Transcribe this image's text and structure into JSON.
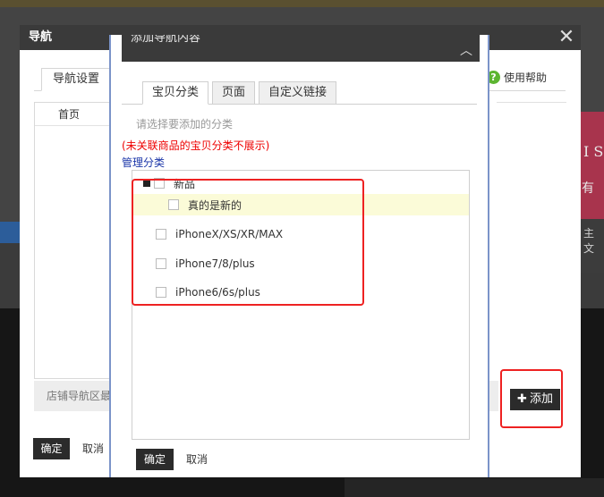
{
  "background": {
    "pink_text_1": "I S",
    "pink_text_2": "有",
    "mid_text": "主 文"
  },
  "outer_dialog": {
    "title": "导航",
    "close_glyph": "✕",
    "tab_label": "导航设置",
    "help": {
      "icon_glyph": "?",
      "label": "使用帮助"
    },
    "left_panel_header": "首页",
    "left_note": "店铺导航区最多",
    "add_button": {
      "plus": "✚",
      "label": "添加"
    },
    "confirm_label": "确定",
    "cancel_label": "取消"
  },
  "inner_dialog": {
    "title": "添加导航内容",
    "collapse_glyph": "︿",
    "tabs": [
      {
        "label": "宝贝分类",
        "active": true
      },
      {
        "label": "页面",
        "active": false
      },
      {
        "label": "自定义链接",
        "active": false
      }
    ],
    "hint": "请选择要添加的分类",
    "warning": "(未关联商品的宝贝分类不展示)",
    "manage_link": "管理分类",
    "tree": [
      {
        "label": "新品",
        "expanded": true,
        "level": 0
      },
      {
        "label": "真的是新的",
        "level": 1,
        "highlighted": true
      },
      {
        "label": "iPhoneX/XS/XR/MAX",
        "level": 0
      },
      {
        "label": "iPhone7/8/plus",
        "level": 0
      },
      {
        "label": "iPhone6/6s/plus",
        "level": 0
      }
    ],
    "confirm_label": "确定",
    "cancel_label": "取消"
  },
  "colors": {
    "title_bar": "#3a3a3a",
    "highlight_border": "#ee2222",
    "warning_text": "#ee0000",
    "link_text": "#1a35a8",
    "selected_row": "#fbfbd8",
    "help_icon": "#5cb531"
  }
}
